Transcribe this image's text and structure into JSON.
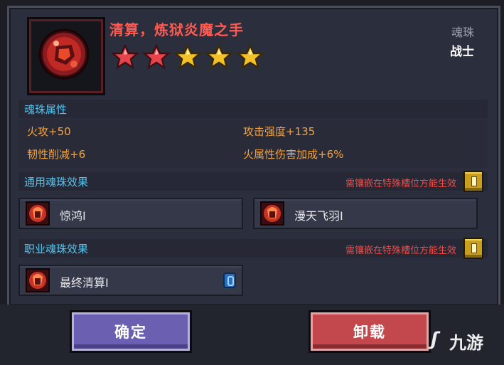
{
  "item": {
    "title": "清算，炼狱炎魔之手",
    "type": "魂珠",
    "class": "战士",
    "stars": [
      {
        "color": "#e8434a",
        "filled": true
      },
      {
        "color": "#e8434a",
        "filled": true
      },
      {
        "color": "#f2c228",
        "filled": true
      },
      {
        "color": "#f2c228",
        "filled": true
      },
      {
        "color": "#f2c228",
        "filled": true
      }
    ],
    "icon": "fire-demon-hand-orb-icon"
  },
  "attributes": {
    "title": "魂珠属性",
    "items": [
      "火攻+50",
      "攻击强度+135",
      "韧性削减+6",
      "火属性伤害加成+6%"
    ]
  },
  "general_effects": {
    "title": "通用魂珠效果",
    "requirement": "需镶嵌在特殊槽位方能生效",
    "items": [
      {
        "label": "惊鸿Ⅰ",
        "icon": "fire-hand-icon"
      },
      {
        "label": "漫天飞羽Ⅰ",
        "icon": "fire-hand-icon"
      }
    ]
  },
  "class_effects": {
    "title": "职业魂珠效果",
    "requirement": "需镶嵌在特殊槽位方能生效",
    "items": [
      {
        "label": "最终清算Ⅰ",
        "icon": "fire-hand-icon",
        "badge_icon": "blue-socket-icon"
      }
    ]
  },
  "buttons": {
    "confirm": "确定",
    "unequip": "卸载"
  },
  "watermark": "九游"
}
